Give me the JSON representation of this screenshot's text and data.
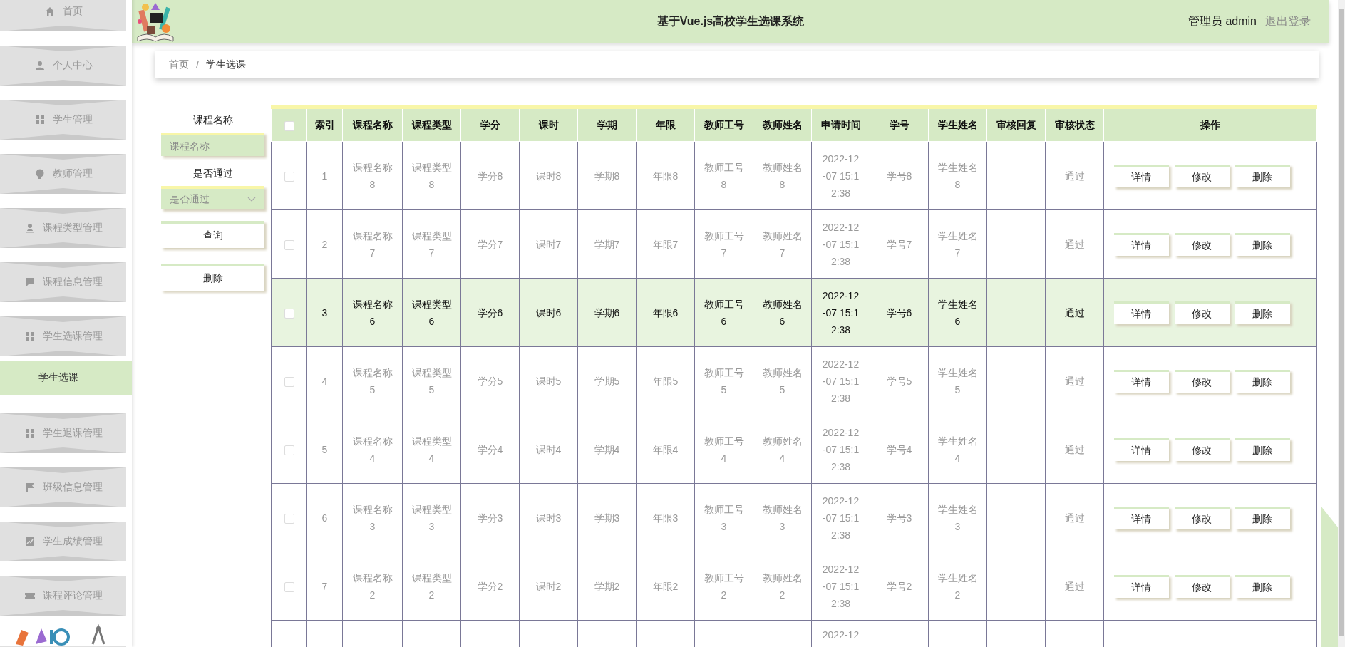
{
  "sidebar": {
    "items": [
      {
        "label": "首页",
        "selected": false
      },
      {
        "label": "个人中心",
        "selected": false
      },
      {
        "label": "学生管理",
        "selected": false
      },
      {
        "label": "教师管理",
        "selected": false
      },
      {
        "label": "课程类型管理",
        "selected": false
      },
      {
        "label": "课程信息管理",
        "selected": false
      },
      {
        "label": "学生选课管理",
        "selected": false,
        "children": [
          {
            "label": "学生选课",
            "selected": true
          }
        ]
      },
      {
        "label": "学生退课管理",
        "selected": false
      },
      {
        "label": "班级信息管理",
        "selected": false
      },
      {
        "label": "学生成绩管理",
        "selected": false
      },
      {
        "label": "课程评论管理",
        "selected": false
      }
    ]
  },
  "header": {
    "title": "基于Vue.js高校学生选课系统",
    "user": "管理员 admin",
    "logout": "退出登录"
  },
  "breadcrumb": {
    "items": [
      "首页",
      "学生选课"
    ],
    "separator": "/"
  },
  "search": {
    "fields": [
      {
        "kind": "input",
        "label": "课程名称",
        "placeholder": "课程名称"
      },
      {
        "kind": "select",
        "label": "是否通过",
        "placeholder": "是否通过"
      }
    ],
    "buttons": [
      "查询",
      "删除"
    ]
  },
  "table": {
    "select_all": {
      "checked": false
    },
    "columns": [
      "索引",
      "课程名称",
      "课程类型",
      "学分",
      "课时",
      "学期",
      "年限",
      "教师工号",
      "教师姓名",
      "申请时间",
      "学号",
      "学生姓名",
      "审核回复",
      "审核状态",
      "操作"
    ],
    "rows": [
      {
        "checked": false,
        "selected": false,
        "cells": {
          "index": "1",
          "course_name": "课程名称8",
          "course_type": "课程类型8",
          "credit": "学分8",
          "hours": "课时8",
          "term": "学期8",
          "years": "年限8",
          "teacher_no": "教师工号8",
          "teacher_name": "教师姓名8",
          "apply_time": "2022-12-07 15:12:38",
          "student_no": "学号8",
          "student_name": "学生姓名8",
          "status": "通过"
        },
        "actions": [
          "详情",
          "修改",
          "删除"
        ]
      },
      {
        "checked": false,
        "selected": false,
        "cells": {
          "index": "2",
          "course_name": "课程名称7",
          "course_type": "课程类型7",
          "credit": "学分7",
          "hours": "课时7",
          "term": "学期7",
          "years": "年限7",
          "teacher_no": "教师工号7",
          "teacher_name": "教师姓名7",
          "apply_time": "2022-12-07 15:12:38",
          "student_no": "学号7",
          "student_name": "学生姓名7",
          "status": "通过"
        },
        "actions": [
          "详情",
          "修改",
          "删除"
        ]
      },
      {
        "checked": false,
        "selected": true,
        "cells": {
          "index": "3",
          "course_name": "课程名称6",
          "course_type": "课程类型6",
          "credit": "学分6",
          "hours": "课时6",
          "term": "学期6",
          "years": "年限6",
          "teacher_no": "教师工号6",
          "teacher_name": "教师姓名6",
          "apply_time": "2022-12-07 15:12:38",
          "student_no": "学号6",
          "student_name": "学生姓名6",
          "status": "通过"
        },
        "actions": [
          "详情",
          "修改",
          "删除"
        ]
      },
      {
        "checked": false,
        "selected": false,
        "cells": {
          "index": "4",
          "course_name": "课程名称5",
          "course_type": "课程类型5",
          "credit": "学分5",
          "hours": "课时5",
          "term": "学期5",
          "years": "年限5",
          "teacher_no": "教师工号5",
          "teacher_name": "教师姓名5",
          "apply_time": "2022-12-07 15:12:38",
          "student_no": "学号5",
          "student_name": "学生姓名5",
          "status": "通过"
        },
        "actions": [
          "详情",
          "修改",
          "删除"
        ]
      },
      {
        "checked": false,
        "selected": false,
        "cells": {
          "index": "5",
          "course_name": "课程名称4",
          "course_type": "课程类型4",
          "credit": "学分4",
          "hours": "课时4",
          "term": "学期4",
          "years": "年限4",
          "teacher_no": "教师工号4",
          "teacher_name": "教师姓名4",
          "apply_time": "2022-12-07 15:12:38",
          "student_no": "学号4",
          "student_name": "学生姓名4",
          "status": "通过"
        },
        "actions": [
          "详情",
          "修改",
          "删除"
        ]
      },
      {
        "checked": false,
        "selected": false,
        "cells": {
          "index": "6",
          "course_name": "课程名称3",
          "course_type": "课程类型3",
          "credit": "学分3",
          "hours": "课时3",
          "term": "学期3",
          "years": "年限3",
          "teacher_no": "教师工号3",
          "teacher_name": "教师姓名3",
          "apply_time": "2022-12-07 15:12:38",
          "student_no": "学号3",
          "student_name": "学生姓名3",
          "status": "通过"
        },
        "actions": [
          "详情",
          "修改",
          "删除"
        ]
      },
      {
        "checked": false,
        "selected": false,
        "cells": {
          "index": "7",
          "course_name": "课程名称2",
          "course_type": "课程类型2",
          "credit": "学分2",
          "hours": "课时2",
          "term": "学期2",
          "years": "年限2",
          "teacher_no": "教师工号2",
          "teacher_name": "教师姓名2",
          "apply_time": "2022-12-07 15:12:38",
          "student_no": "学号2",
          "student_name": "学生姓名2",
          "status": "通过"
        },
        "actions": [
          "详情",
          "修改",
          "删除"
        ]
      },
      {
        "selected": false,
        "cells": {
          "apply_time": "2022-12"
        }
      }
    ]
  }
}
